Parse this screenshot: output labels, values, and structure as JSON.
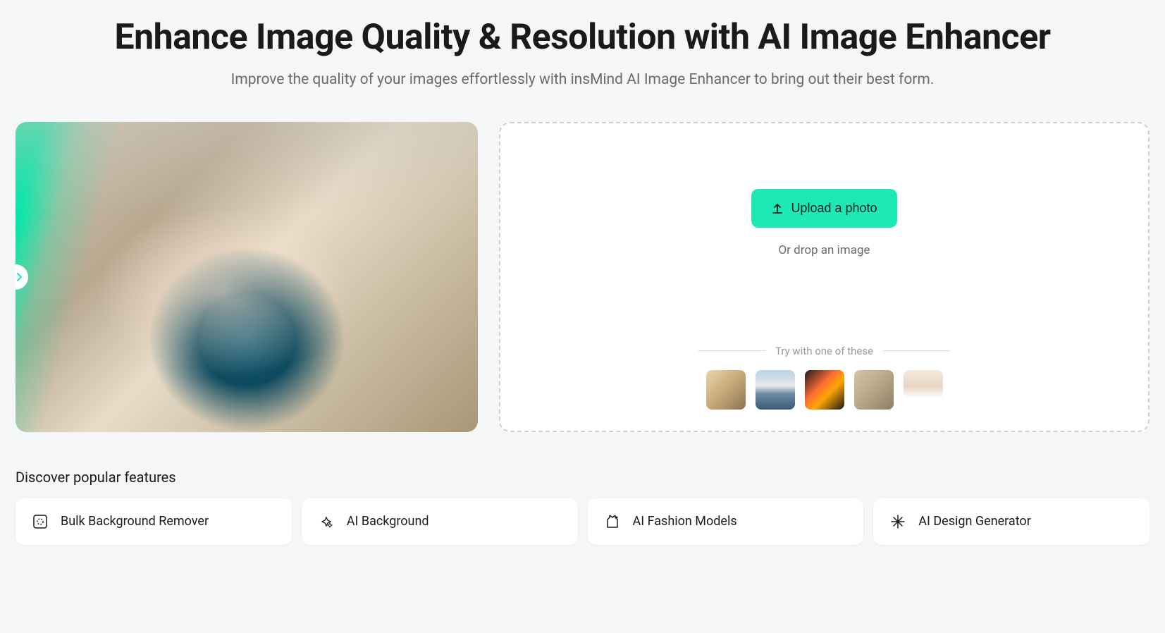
{
  "header": {
    "title": "Enhance Image Quality & Resolution with AI Image Enhancer",
    "subtitle": "Improve the quality of your images effortlessly with insMind AI Image Enhancer to bring out their best form."
  },
  "upload": {
    "button_label": "Upload a photo",
    "drop_text": "Or drop an image",
    "samples_label": "Try with one of these"
  },
  "features": {
    "title": "Discover popular features",
    "items": [
      {
        "label": "Bulk Background Remover"
      },
      {
        "label": "AI Background"
      },
      {
        "label": "AI Fashion Models"
      },
      {
        "label": "AI Design Generator"
      }
    ]
  }
}
